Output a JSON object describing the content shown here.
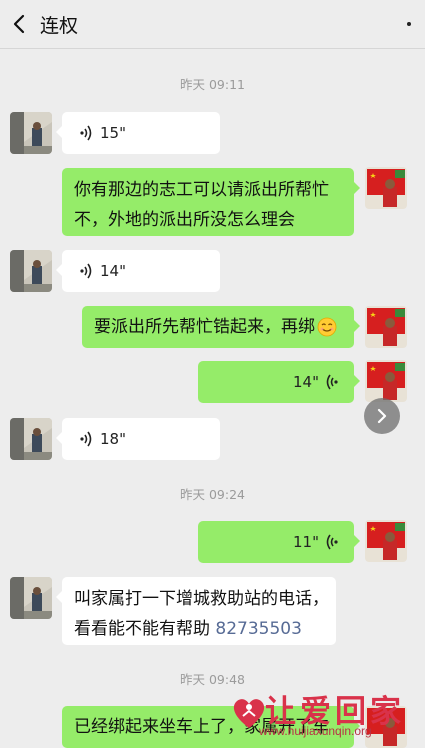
{
  "header": {
    "title": "连权"
  },
  "timestamps": [
    "昨天 09:11",
    "昨天 09:24",
    "昨天 09:48"
  ],
  "messages": [
    {
      "side": "left",
      "type": "voice",
      "duration": "15\""
    },
    {
      "side": "right",
      "type": "text",
      "lines": [
        "你有那边的志工可以请派出所帮忙",
        "不，外地的派出所没怎么理会"
      ]
    },
    {
      "side": "left",
      "type": "voice",
      "duration": "14\""
    },
    {
      "side": "right",
      "type": "text",
      "lines": [
        "要派出所先帮忙锆起来，再绑"
      ],
      "emoji": "smile-emoji"
    },
    {
      "side": "right",
      "type": "voice",
      "duration": "14\""
    },
    {
      "side": "left",
      "type": "voice",
      "duration": "18\""
    },
    {
      "side": "right",
      "type": "voice",
      "duration": "11\""
    },
    {
      "side": "left",
      "type": "text",
      "lines": [
        "叫家属打一下增城救助站的电话，",
        "看看能不能有帮助"
      ],
      "phone": "82735503"
    },
    {
      "side": "right",
      "type": "text",
      "lines": [
        "已经绑起来坐车上了，家属开了车"
      ]
    }
  ],
  "watermark": {
    "text": "让爱回家",
    "url": "www.huijiaxunqin.org"
  },
  "colors": {
    "background": "#ededed",
    "bubble_right": "#95ec69",
    "bubble_left": "#ffffff",
    "link": "#576b95",
    "watermark": "#d9324a"
  }
}
